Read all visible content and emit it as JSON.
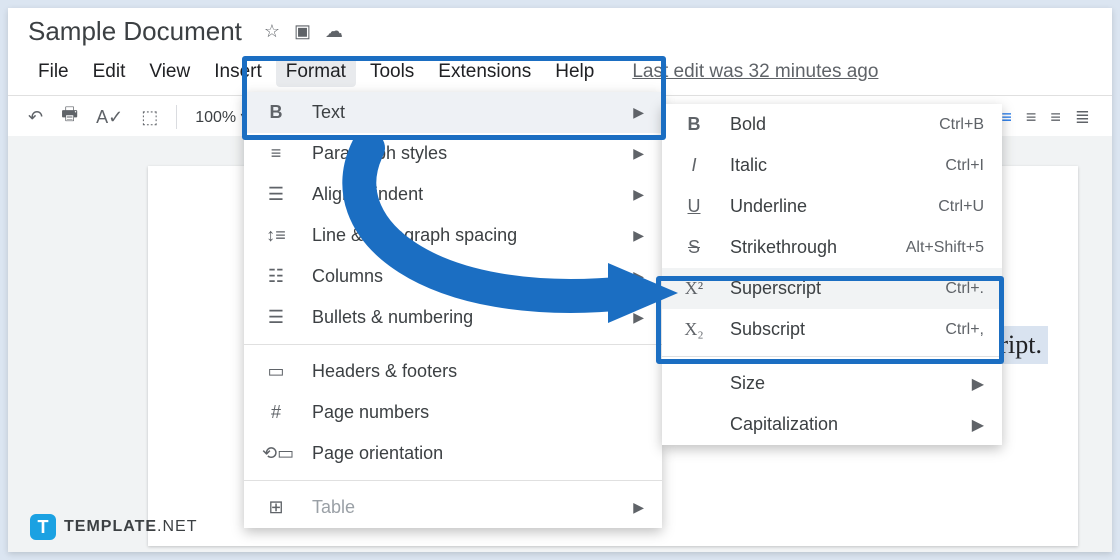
{
  "doc_title": "Sample Document",
  "menubar": {
    "file": "File",
    "edit": "Edit",
    "view": "View",
    "insert": "Insert",
    "format": "Format",
    "tools": "Tools",
    "extensions": "Extensions",
    "help": "Help",
    "last_edit": "Last edit was 32 minutes ago"
  },
  "toolbar": {
    "zoom": "100%"
  },
  "format_menu": {
    "text": "Text",
    "paragraph_styles": "Paragraph styles",
    "align_indent": "Align & indent",
    "line_spacing": "Line & paragraph spacing",
    "columns": "Columns",
    "bullets_numbering": "Bullets & numbering",
    "headers_footers": "Headers & footers",
    "page_numbers": "Page numbers",
    "page_orientation": "Page orientation",
    "table": "Table"
  },
  "text_submenu": {
    "bold": {
      "label": "Bold",
      "key": "Ctrl+B"
    },
    "italic": {
      "label": "Italic",
      "key": "Ctrl+I"
    },
    "underline": {
      "label": "Underline",
      "key": "Ctrl+U"
    },
    "strikethrough": {
      "label": "Strikethrough",
      "key": "Alt+Shift+5"
    },
    "superscript": {
      "label": "Superscript",
      "key": "Ctrl+."
    },
    "subscript": {
      "label": "Subscript",
      "key": "Ctrl+,"
    },
    "size": "Size",
    "capitalization": "Capitalization"
  },
  "selected_text": "script.",
  "brand": {
    "name": "TEMPLATE",
    "suffix": ".NET"
  }
}
